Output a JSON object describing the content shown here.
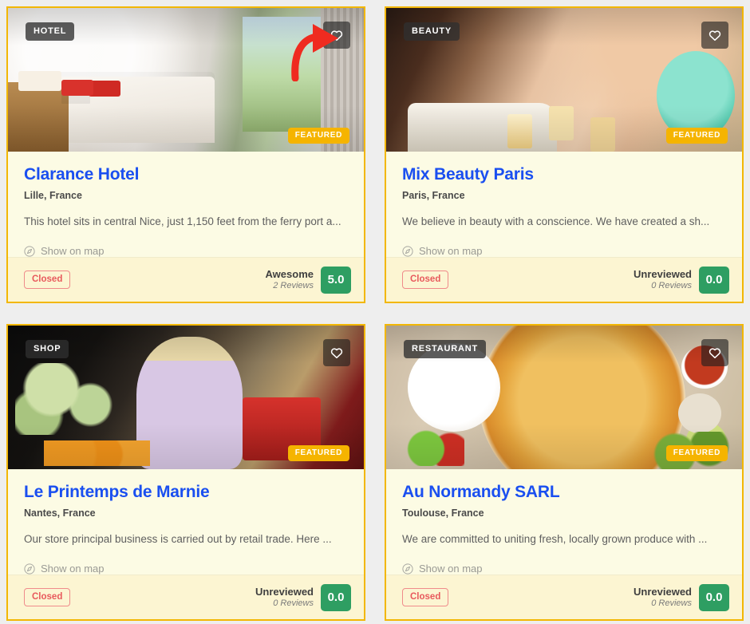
{
  "listing_grid": {
    "cards": [
      {
        "id": "clarance-hotel",
        "category": "HOTEL",
        "featured_label": "FEATURED",
        "favorite_icon": "heart-icon",
        "title": "Clarance Hotel",
        "location": "Lille, France",
        "description": "This hotel sits in central Nice, just 1,150 feet from the ferry port a...",
        "map_link": "Show on map",
        "map_icon": "compass-icon",
        "status": "Closed",
        "rating_label": "Awesome",
        "rating_count": "2 Reviews",
        "rating_score": "5.0"
      },
      {
        "id": "mix-beauty-paris",
        "category": "BEAUTY",
        "featured_label": "FEATURED",
        "favorite_icon": "heart-icon",
        "title": "Mix Beauty Paris",
        "location": "Paris, France",
        "description": "We believe in beauty with a conscience. We have created a sh...",
        "map_link": "Show on map",
        "map_icon": "compass-icon",
        "status": "Closed",
        "rating_label": "Unreviewed",
        "rating_count": "0 Reviews",
        "rating_score": "0.0"
      },
      {
        "id": "le-printemps-de-marnie",
        "category": "SHOP",
        "featured_label": "FEATURED",
        "favorite_icon": "heart-icon",
        "title": "Le Printemps de Marnie",
        "location": "Nantes, France",
        "description": "Our store principal business is carried out by retail trade. Here ...",
        "map_link": "Show on map",
        "map_icon": "compass-icon",
        "status": "Closed",
        "rating_label": "Unreviewed",
        "rating_count": "0 Reviews",
        "rating_score": "0.0"
      },
      {
        "id": "au-normandy-sarl",
        "category": "RESTAURANT",
        "featured_label": "FEATURED",
        "favorite_icon": "heart-icon",
        "title": "Au Normandy SARL",
        "location": "Toulouse, France",
        "description": "We are committed to uniting fresh, locally grown produce with ...",
        "map_link": "Show on map",
        "map_icon": "compass-icon",
        "status": "Closed",
        "rating_label": "Unreviewed",
        "rating_count": "0 Reviews",
        "rating_score": "0.0"
      }
    ]
  },
  "annotation": {
    "arrow_icon": "red-arrow-annotation",
    "arrow_color": "#ef2b20",
    "points_to": "favorite-button-card-1"
  },
  "colors": {
    "card_border": "#f2b705",
    "card_bg": "#fcfbe4",
    "card_footer_bg": "#fcf5d2",
    "title_link": "#1a4ff0",
    "featured_badge": "#f5b400",
    "rating_green": "#2e9e62",
    "status_red": "#e8595c",
    "page_bg": "#eeeeee"
  }
}
